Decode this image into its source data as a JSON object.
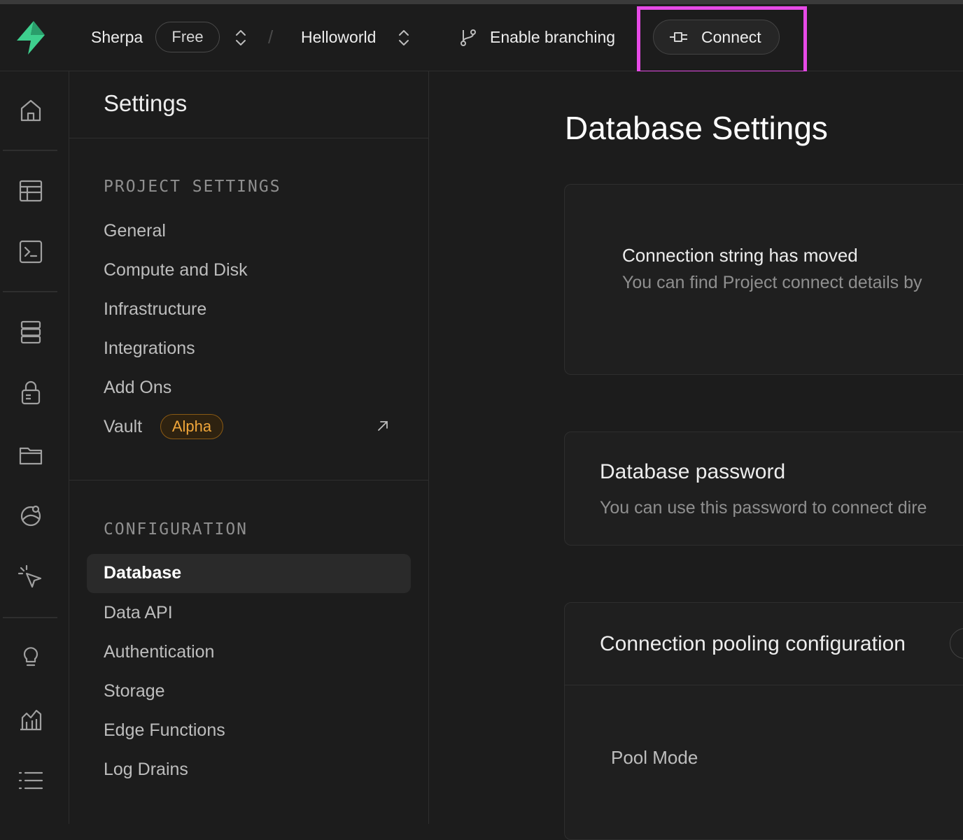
{
  "topbar": {
    "org_name": "Sherpa",
    "plan_badge": "Free",
    "project_name": "Helloworld",
    "branching_label": "Enable branching",
    "connect_label": "Connect"
  },
  "rail": {
    "icons": [
      "home-icon",
      "table-editor-icon",
      "sql-editor-icon",
      "database-icon",
      "auth-icon",
      "storage-icon",
      "realtime-icon",
      "edge-functions-icon",
      "advisors-icon",
      "reports-icon",
      "logs-icon"
    ]
  },
  "settings": {
    "title": "Settings",
    "project_section": "PROJECT SETTINGS",
    "project_items": [
      "General",
      "Compute and Disk",
      "Infrastructure",
      "Integrations",
      "Add Ons",
      "Vault"
    ],
    "vault_badge": "Alpha",
    "config_section": "CONFIGURATION",
    "config_items": [
      "Database",
      "Data API",
      "Authentication",
      "Storage",
      "Edge Functions",
      "Log Drains"
    ]
  },
  "main": {
    "title": "Database Settings",
    "connection_card": {
      "title": "Connection string has moved",
      "description": "You can find Project connect details by"
    },
    "password_card": {
      "title": "Database password",
      "description": "You can use this password to connect dire"
    },
    "pooling_card": {
      "title": "Connection pooling configuration",
      "pool_mode_label": "Pool Mode"
    }
  },
  "colors": {
    "brand_green": "#3ecf8e",
    "highlight": "#e64ae6",
    "alpha_badge": "#f0a63a"
  }
}
